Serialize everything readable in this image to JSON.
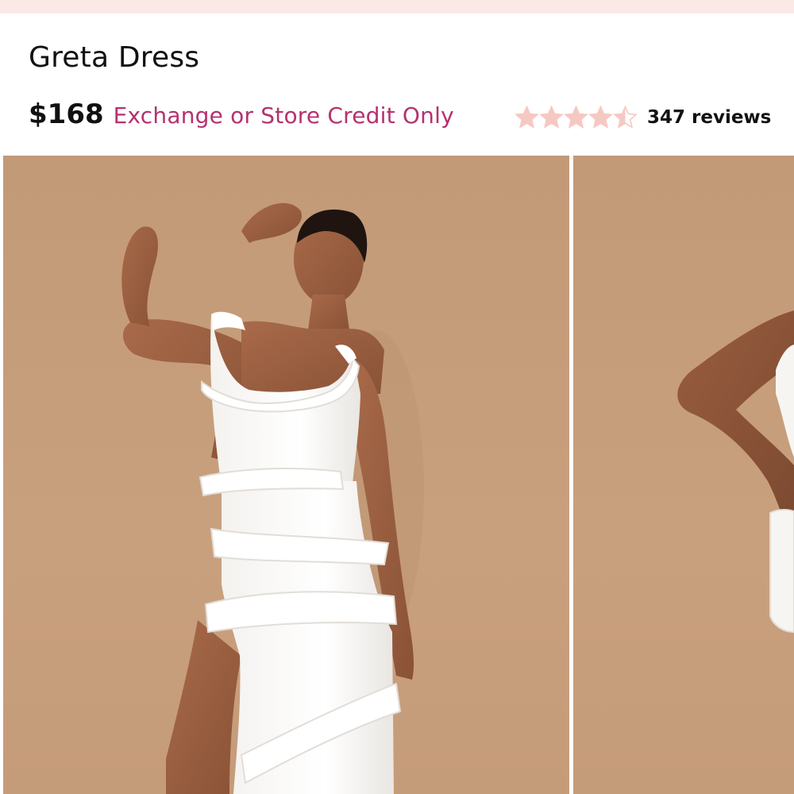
{
  "product": {
    "title": "Greta Dress",
    "price": "$168",
    "return_policy": "Exchange or Store Credit Only"
  },
  "rating": {
    "value": 4.5,
    "max": 5,
    "reviews_label": "347 reviews",
    "star_color": "#f6c8c3",
    "star_icon": "star-icon"
  },
  "colors": {
    "top_band": "#fbe9e7",
    "policy_text": "#b5316f",
    "photo_backdrop": "#c59c79"
  },
  "gallery": {
    "images": [
      {
        "subject": "model in white ruffle maxi dress, arm raised behind head"
      },
      {
        "subject": "model in white ruffle dress, hand on hip (cropped)"
      }
    ]
  }
}
